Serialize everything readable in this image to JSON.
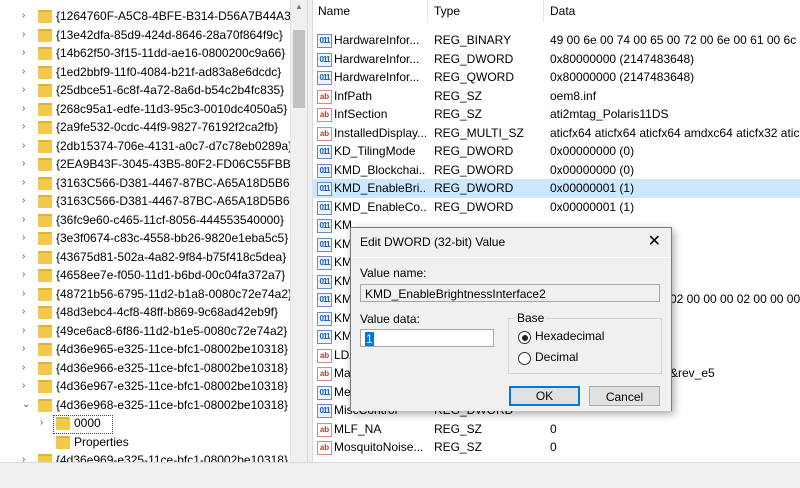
{
  "tree": {
    "keys": [
      "{1264760F-A5C8-4BFE-B314-D56A7B44A362}",
      "{13e42dfa-85d9-424d-8646-28a70f864f9c}",
      "{14b62f50-3f15-11dd-ae16-0800200c9a66}",
      "{1ed2bbf9-11f0-4084-b21f-ad83a8e6dcdc}",
      "{25dbce51-6c8f-4a72-8a6d-b54c2b4fc835}",
      "{268c95a1-edfe-11d3-95c3-0010dc4050a5}",
      "{2a9fe532-0cdc-44f9-9827-76192f2ca2fb}",
      "{2db15374-706e-4131-a0c7-d7c78eb0289a}",
      "{2EA9B43F-3045-43B5-80F2-FD06C55FBB90}",
      "{3163C566-D381-4467-87BC-A65A18D5B648}",
      "{3163C566-D381-4467-87BC-A65A18D5B649}",
      "{36fc9e60-c465-11cf-8056-444553540000}",
      "{3e3f0674-c83c-4558-bb26-9820e1eba5c5}",
      "{43675d81-502a-4a82-9f84-b75f418c5dea}",
      "{4658ee7e-f050-11d1-b6bd-00c04fa372a7}",
      "{48721b56-6795-11d2-b1a8-0080c72e74a2}",
      "{48d3ebc4-4cf8-48ff-b869-9c68ad42eb9f}",
      "{49ce6ac8-6f86-11d2-b1e5-0080c72e74a2}",
      "{4d36e965-e325-11ce-bfc1-08002be10318}",
      "{4d36e966-e325-11ce-bfc1-08002be10318}",
      "{4d36e967-e325-11ce-bfc1-08002be10318}",
      "{4d36e968-e325-11ce-bfc1-08002be10318}"
    ],
    "child_selected": "0000",
    "child_properties": "Properties",
    "partial_last": "{4d36e969-e325-11ce-bfc1-08002be10318}"
  },
  "list": {
    "headers": {
      "name": "Name",
      "type": "Type",
      "data": "Data"
    },
    "rows": [
      {
        "icon": "binary",
        "name": "HardwareInfor...",
        "type": "REG_BINARY",
        "data": "49 00 6e 00 74 00 65 00 72 00 6e 00 61 00 6c 00 20 00"
      },
      {
        "icon": "binary",
        "name": "HardwareInfor...",
        "type": "REG_DWORD",
        "data": "0x80000000 (2147483648)"
      },
      {
        "icon": "binary",
        "name": "HardwareInfor...",
        "type": "REG_QWORD",
        "data": "0x80000000 (2147483648)"
      },
      {
        "icon": "string",
        "name": "InfPath",
        "type": "REG_SZ",
        "data": "oem8.inf"
      },
      {
        "icon": "string",
        "name": "InfSection",
        "type": "REG_SZ",
        "data": "ati2mtag_Polaris11DS"
      },
      {
        "icon": "string",
        "name": "InstalledDisplay...",
        "type": "REG_MULTI_SZ",
        "data": "aticfx64 aticfx64 aticfx64 amdxc64 aticfx32 aticfx32"
      },
      {
        "icon": "binary",
        "name": "KD_TilingMode",
        "type": "REG_DWORD",
        "data": "0x00000000 (0)"
      },
      {
        "icon": "binary",
        "name": "KMD_Blockchai...",
        "type": "REG_DWORD",
        "data": "0x00000000 (0)"
      },
      {
        "icon": "binary",
        "name": "KMD_EnableBri...",
        "type": "REG_DWORD",
        "data": "0x00000001 (1)",
        "selected": true
      },
      {
        "icon": "binary",
        "name": "KMD_EnableCo...",
        "type": "REG_DWORD",
        "data": "0x00000001 (1)"
      },
      {
        "icon": "binary",
        "name": "KM",
        "type": "",
        "data": ""
      },
      {
        "icon": "binary",
        "name": "KM",
        "type": "",
        "data": ""
      },
      {
        "icon": "binary",
        "name": "KM",
        "type": "",
        "data": ""
      },
      {
        "icon": "binary",
        "name": "KM",
        "type": "",
        "data": ""
      },
      {
        "icon": "binary",
        "name": "KM",
        "type": "",
        "data": "02 00 00 00 02 00 00 00 3c 0"
      },
      {
        "icon": "binary",
        "name": "KM",
        "type": "",
        "data": ""
      },
      {
        "icon": "binary",
        "name": "KM",
        "type": "",
        "data": ""
      },
      {
        "icon": "string",
        "name": "LDA",
        "type": "",
        "data": ""
      },
      {
        "icon": "string",
        "name": "Ma",
        "type": "",
        "data": "&rev_e5"
      },
      {
        "icon": "binary",
        "name": "Me",
        "type": "",
        "data": ""
      },
      {
        "icon": "binary",
        "name": "MiscControl",
        "type": "REG_DWORD",
        "data": ""
      },
      {
        "icon": "string",
        "name": "MLF_NA",
        "type": "REG_SZ",
        "data": "0"
      },
      {
        "icon": "string",
        "name": "MosquitoNoise...",
        "type": "REG_SZ",
        "data": "0"
      }
    ]
  },
  "dialog": {
    "title": "Edit DWORD (32-bit) Value",
    "value_name_label": "Value name:",
    "value_name": "KMD_EnableBrightnessInterface2",
    "value_data_label": "Value data:",
    "value_data": "1",
    "base_label": "Base",
    "radio_hex": "Hexadecimal",
    "radio_dec": "Decimal",
    "base_selected": "Hexadecimal",
    "ok_label": "OK",
    "cancel_label": "Cancel",
    "close_glyph": "✕"
  }
}
